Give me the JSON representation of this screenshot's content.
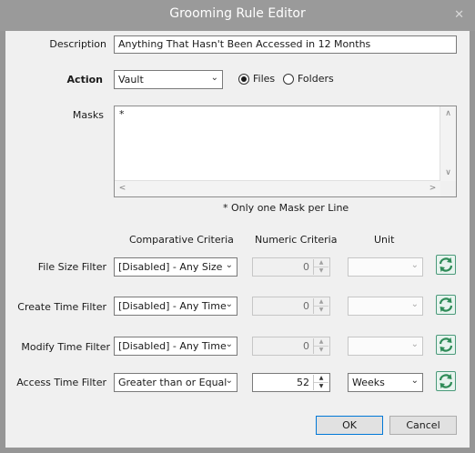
{
  "window": {
    "title": "Grooming Rule Editor",
    "close_glyph": "✕"
  },
  "description": {
    "label": "Description",
    "value": "Anything That Hasn't Been Accessed in 12 Months"
  },
  "action": {
    "label": "Action",
    "value": "Vault",
    "radio_files_label": "Files",
    "radio_folders_label": "Folders",
    "selected": "Files"
  },
  "masks": {
    "label": "Masks",
    "value": "*",
    "note": "* Only one Mask per Line"
  },
  "headers": {
    "comparative": "Comparative Criteria",
    "numeric": "Numeric Criteria",
    "unit": "Unit"
  },
  "filters": [
    {
      "label": "File Size Filter",
      "criteria": "[Disabled] - Any Size",
      "numeric": "0",
      "unit": "",
      "enabled": false
    },
    {
      "label": "Create Time Filter",
      "criteria": "[Disabled] - Any Time",
      "numeric": "0",
      "unit": "",
      "enabled": false
    },
    {
      "label": "Modify Time Filter",
      "criteria": "[Disabled] - Any Time",
      "numeric": "0",
      "unit": "",
      "enabled": false
    },
    {
      "label": "Access Time Filter",
      "criteria": "Greater than or Equal",
      "numeric": "52",
      "unit": "Weeks",
      "enabled": true
    }
  ],
  "buttons": {
    "ok": "OK",
    "cancel": "Cancel"
  },
  "colors": {
    "accent": "#0078d7",
    "refresh_icon": "#2e8b57"
  }
}
